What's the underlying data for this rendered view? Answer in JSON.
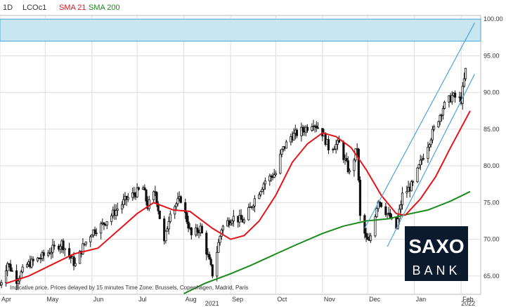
{
  "header": {
    "interval": "1D",
    "symbol": "LCOc1",
    "sma21_label": "SMA 21",
    "sma200_label": "SMA 200"
  },
  "footnote": "Indicative price. Prices delayed by 15 minutes    Time Zone: Brussels, Copenhagen, Madrid, Paris",
  "logo": {
    "line1": "SAXO",
    "line2": "BANK"
  },
  "colors": {
    "sma21": "#e3151a",
    "sma200": "#1a8a1a",
    "channel": "#4fa3d8",
    "zone_fill": "#c8e6f0",
    "zone_border": "#4fa3d8",
    "candle": "#111111",
    "grid": "#dddddd",
    "logo_bg": "#0c1a2e"
  },
  "chart_data": {
    "type": "candlestick",
    "series_name": "LCOc1",
    "interval": "1D",
    "ylim": [
      62.5,
      100.5
    ],
    "yticks": [
      65,
      70,
      75,
      80,
      85,
      90,
      95,
      100
    ],
    "ytick_labels": [
      "65.00",
      "70.00",
      "75.00",
      "80.00",
      "85.00",
      "90.00",
      "95.00",
      "100.00"
    ],
    "xlim": [
      "2021-04-01",
      "2022-02-14"
    ],
    "month_ticks": [
      {
        "date": "2021-04-01",
        "label": "Apr"
      },
      {
        "date": "2021-05-01",
        "label": "May"
      },
      {
        "date": "2021-06-01",
        "label": "Jun"
      },
      {
        "date": "2021-07-01",
        "label": "Jul"
      },
      {
        "date": "2021-08-01",
        "label": "Aug"
      },
      {
        "date": "2021-09-01",
        "label": "Sep"
      },
      {
        "date": "2021-10-01",
        "label": "Oct"
      },
      {
        "date": "2021-11-01",
        "label": "Nov"
      },
      {
        "date": "2021-12-01",
        "label": "Dec"
      },
      {
        "date": "2022-01-01",
        "label": "Jan"
      },
      {
        "date": "2022-02-01",
        "label": "Feb"
      }
    ],
    "year_labels": [
      {
        "date": "2021-08-15",
        "label": "2021"
      },
      {
        "date": "2022-02-01",
        "label": "2022"
      }
    ],
    "price_path": [
      [
        "2021-04-01",
        63.8
      ],
      [
        "2021-04-06",
        66.8
      ],
      [
        "2021-04-12",
        64.5
      ],
      [
        "2021-04-19",
        66.5
      ],
      [
        "2021-04-28",
        67.5
      ],
      [
        "2021-05-05",
        68.5
      ],
      [
        "2021-05-12",
        69.5
      ],
      [
        "2021-05-17",
        67.8
      ],
      [
        "2021-05-21",
        66.5
      ],
      [
        "2021-05-26",
        69.0
      ],
      [
        "2021-06-01",
        71.0
      ],
      [
        "2021-06-08",
        72.0
      ],
      [
        "2021-06-15",
        73.5
      ],
      [
        "2021-06-24",
        75.5
      ],
      [
        "2021-07-05",
        77.0
      ],
      [
        "2021-07-08",
        74.5
      ],
      [
        "2021-07-13",
        76.5
      ],
      [
        "2021-07-19",
        69.5
      ],
      [
        "2021-07-23",
        74.0
      ],
      [
        "2021-07-30",
        75.5
      ],
      [
        "2021-08-06",
        70.5
      ],
      [
        "2021-08-12",
        71.5
      ],
      [
        "2021-08-20",
        65.3
      ],
      [
        "2021-08-26",
        71.5
      ],
      [
        "2021-09-02",
        73.0
      ],
      [
        "2021-09-10",
        72.5
      ],
      [
        "2021-09-17",
        75.5
      ],
      [
        "2021-09-24",
        78.0
      ],
      [
        "2021-10-01",
        79.0
      ],
      [
        "2021-10-05",
        82.0
      ],
      [
        "2021-10-11",
        84.0
      ],
      [
        "2021-10-20",
        85.0
      ],
      [
        "2021-10-26",
        86.0
      ],
      [
        "2021-11-01",
        84.5
      ],
      [
        "2021-11-05",
        82.5
      ],
      [
        "2021-11-12",
        83.0
      ],
      [
        "2021-11-19",
        79.0
      ],
      [
        "2021-11-24",
        82.5
      ],
      [
        "2021-11-26",
        73.0
      ],
      [
        "2021-11-30",
        70.0
      ],
      [
        "2021-12-02",
        69.5
      ],
      [
        "2021-12-08",
        75.5
      ],
      [
        "2021-12-14",
        73.5
      ],
      [
        "2021-12-20",
        71.5
      ],
      [
        "2021-12-24",
        76.0
      ],
      [
        "2021-12-31",
        77.5
      ],
      [
        "2022-01-07",
        81.5
      ],
      [
        "2022-01-14",
        85.0
      ],
      [
        "2022-01-20",
        88.0
      ],
      [
        "2022-01-26",
        89.5
      ],
      [
        "2022-02-01",
        89.0
      ],
      [
        "2022-02-04",
        93.0
      ]
    ],
    "sma21": [
      [
        "2021-04-05",
        64.0
      ],
      [
        "2021-04-20",
        65.0
      ],
      [
        "2021-05-05",
        66.5
      ],
      [
        "2021-05-20",
        68.0
      ],
      [
        "2021-06-05",
        68.8
      ],
      [
        "2021-06-20",
        71.5
      ],
      [
        "2021-07-01",
        73.5
      ],
      [
        "2021-07-12",
        75.0
      ],
      [
        "2021-07-25",
        74.0
      ],
      [
        "2021-08-05",
        73.8
      ],
      [
        "2021-08-20",
        71.5
      ],
      [
        "2021-09-01",
        70.0
      ],
      [
        "2021-09-10",
        70.5
      ],
      [
        "2021-09-20",
        72.5
      ],
      [
        "2021-10-01",
        76.0
      ],
      [
        "2021-10-12",
        80.5
      ],
      [
        "2021-10-22",
        83.0
      ],
      [
        "2021-11-01",
        84.5
      ],
      [
        "2021-11-10",
        84.0
      ],
      [
        "2021-11-20",
        82.5
      ],
      [
        "2021-11-30",
        79.5
      ],
      [
        "2021-12-10",
        76.0
      ],
      [
        "2021-12-20",
        73.5
      ],
      [
        "2021-12-26",
        73.3
      ],
      [
        "2022-01-05",
        75.5
      ],
      [
        "2022-01-15",
        78.5
      ],
      [
        "2022-01-25",
        82.5
      ],
      [
        "2022-02-07",
        87.5
      ]
    ],
    "sma200": [
      [
        "2021-08-01",
        62.6
      ],
      [
        "2021-08-15",
        64.0
      ],
      [
        "2021-09-01",
        65.3
      ],
      [
        "2021-09-15",
        66.5
      ],
      [
        "2021-10-01",
        68.0
      ],
      [
        "2021-10-15",
        69.3
      ],
      [
        "2021-11-01",
        70.8
      ],
      [
        "2021-11-15",
        71.8
      ],
      [
        "2021-11-30",
        72.5
      ],
      [
        "2021-12-15",
        72.8
      ],
      [
        "2021-12-25",
        73.3
      ],
      [
        "2022-01-10",
        74.0
      ],
      [
        "2022-01-25",
        75.2
      ],
      [
        "2022-02-07",
        76.5
      ]
    ],
    "channel_lines": [
      {
        "start": [
          "2021-11-29",
          71.5
        ],
        "end": [
          "2022-02-10",
          99.5
        ]
      },
      {
        "start": [
          "2021-12-14",
          69.0
        ],
        "end": [
          "2022-02-10",
          92.5
        ]
      }
    ],
    "resistance_zone": [
      97.0,
      100.0
    ],
    "grid": true
  }
}
